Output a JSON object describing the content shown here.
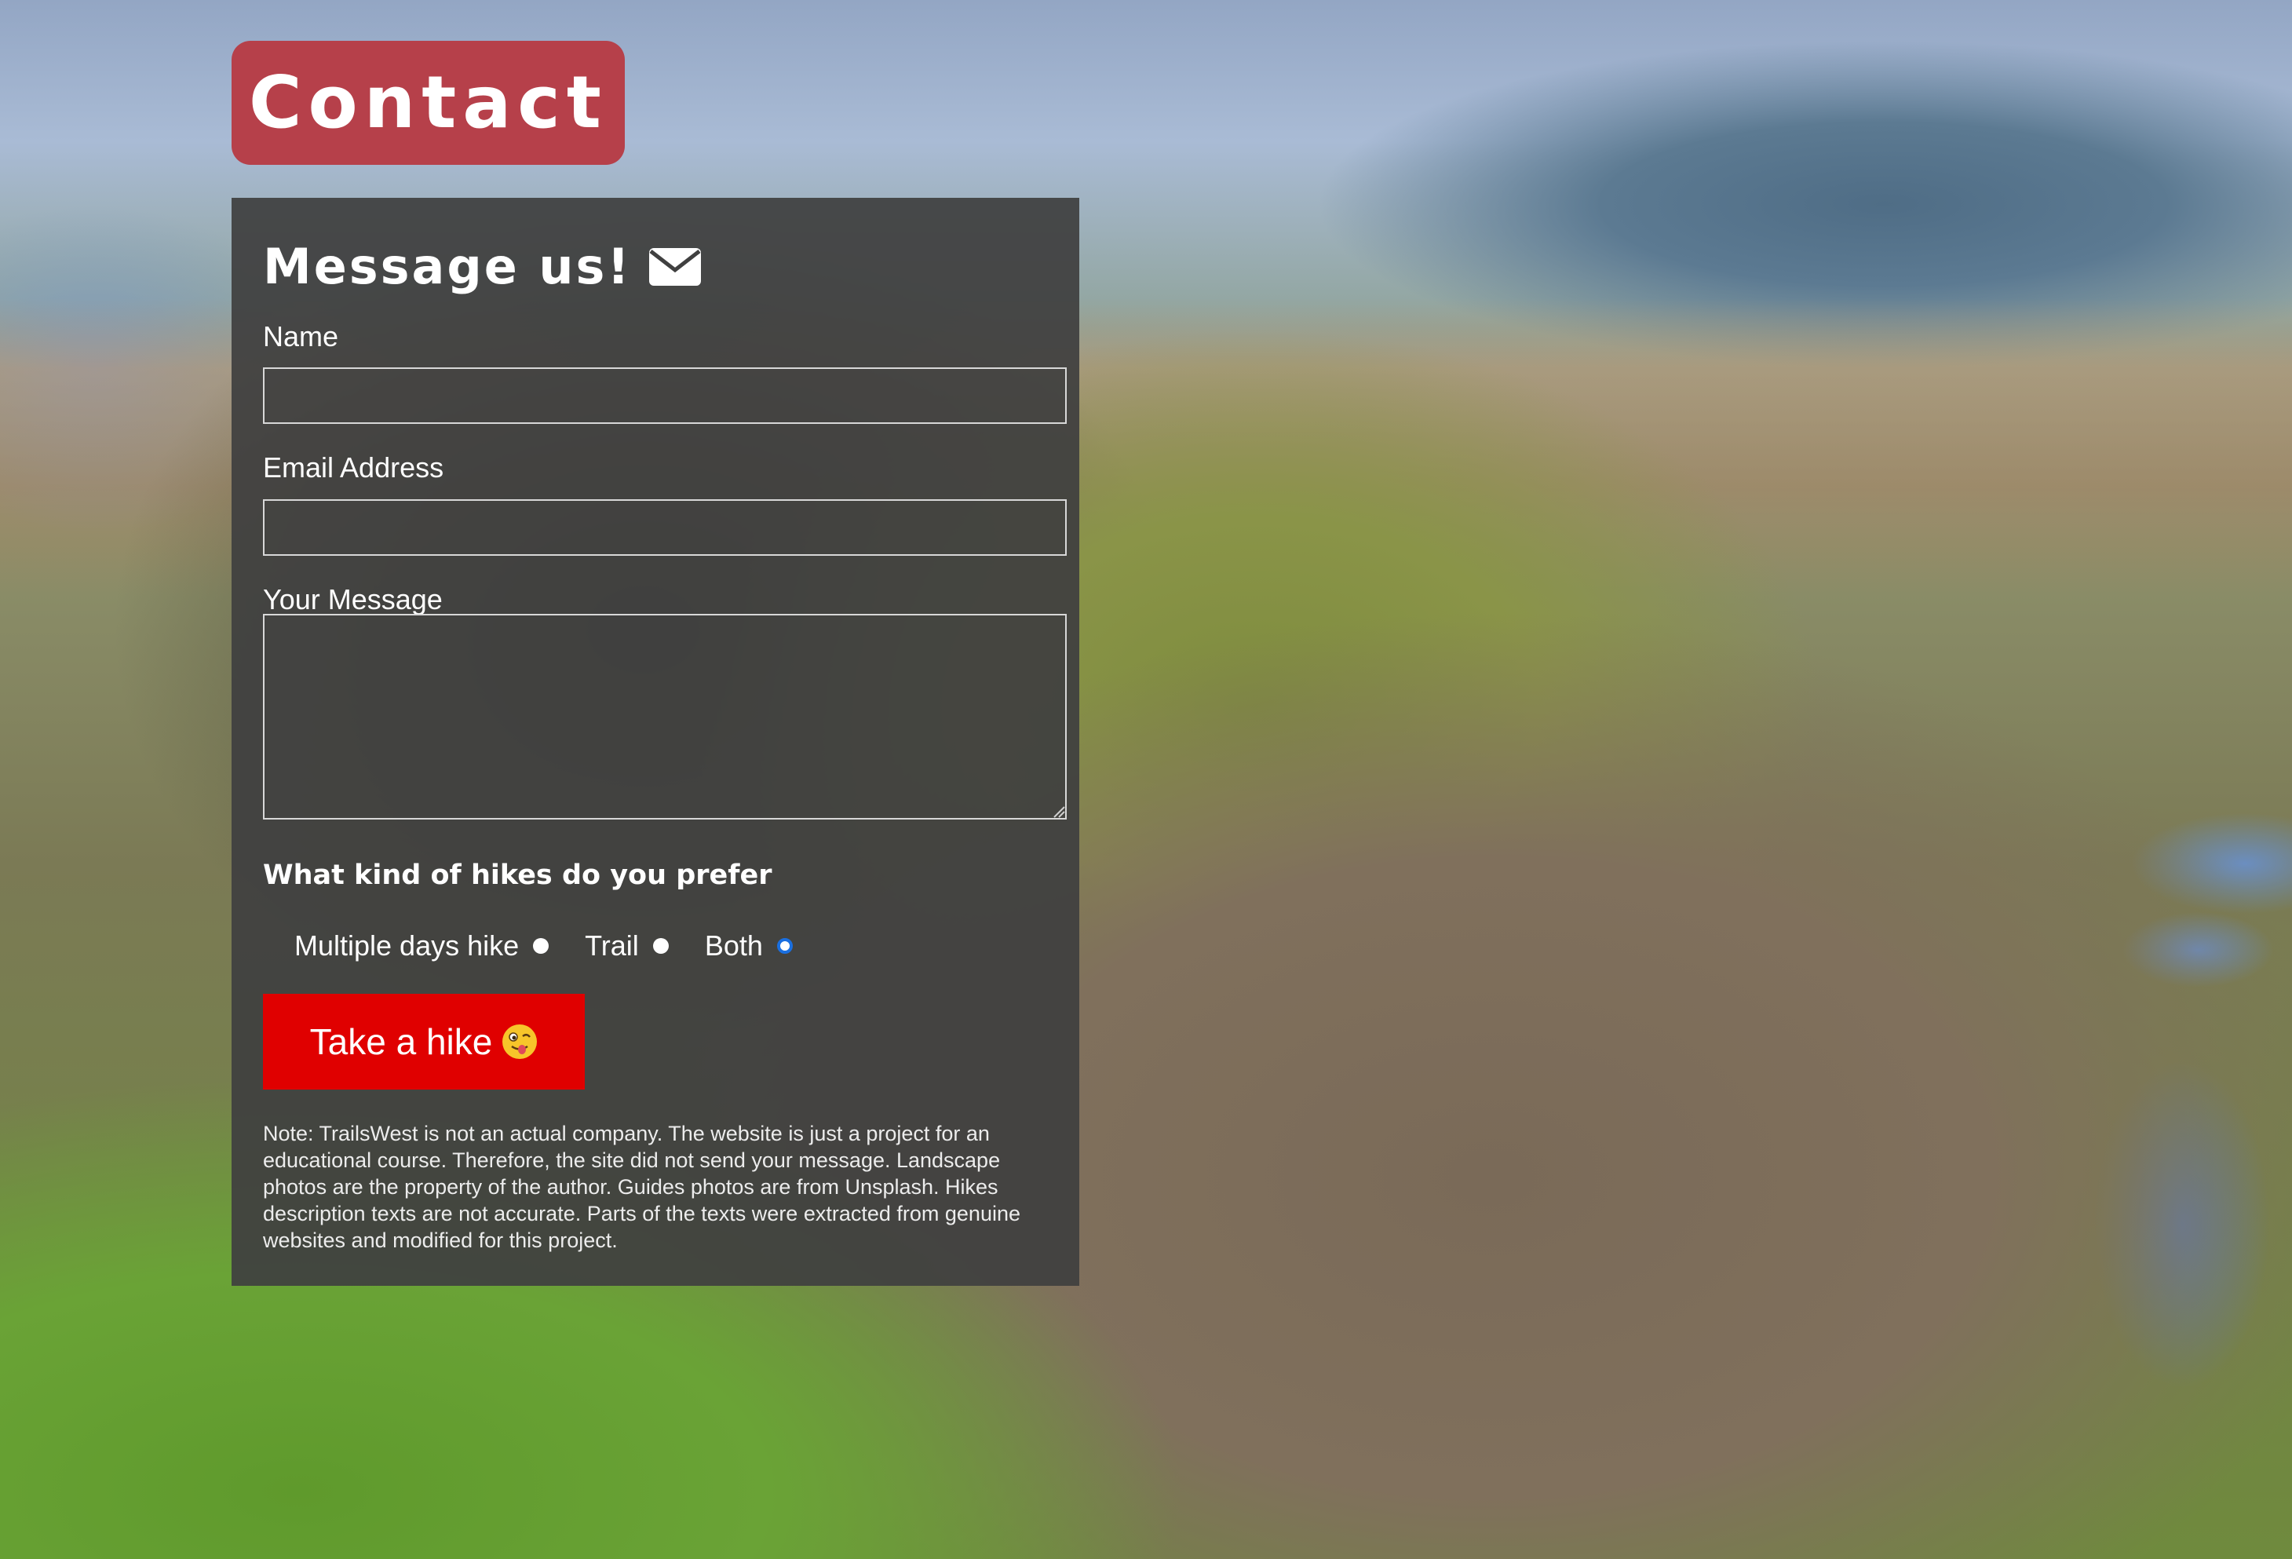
{
  "header": {
    "title": "Contact"
  },
  "form": {
    "heading": "Message us!",
    "heading_icon": "envelope-icon",
    "fields": {
      "name": {
        "label": "Name",
        "value": ""
      },
      "email": {
        "label": "Email Address",
        "value": ""
      },
      "message": {
        "label": "Your Message",
        "value": ""
      }
    },
    "question": "What kind of hikes do you prefer",
    "options": [
      {
        "label": "Multiple days hike",
        "checked": false
      },
      {
        "label": "Trail",
        "checked": false
      },
      {
        "label": "Both",
        "checked": true
      }
    ],
    "submit_label": "Take a hike",
    "submit_icon": "winking-tongue-emoji-icon",
    "note": "Note: TrailsWest is not an actual company. The website is just a project for an educational course. Therefore, the site did not send your message. Landscape photos are the property of the author. Guides photos are from Unsplash. Hikes description texts are not accurate. Parts of the texts were extracted from genuine websites and modified for this project."
  },
  "colors": {
    "title_bg": "#b6404a",
    "panel_bg": "#404040",
    "button_bg": "#e00000",
    "radio_checked": "#1a6fe0"
  }
}
